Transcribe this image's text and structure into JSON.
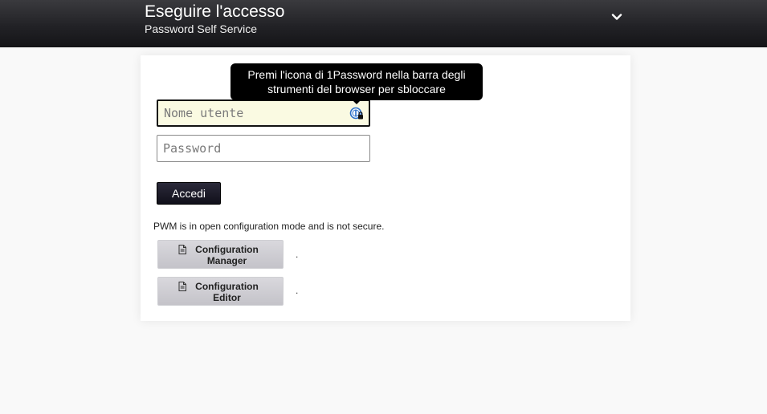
{
  "header": {
    "title": "Eseguire l'accesso",
    "subtitle": "Password Self Service",
    "menu_icon": "chevron-down-icon"
  },
  "tooltip": {
    "text": "Premi l'icona di 1Password nella barra degli strumenti del browser per sbloccare"
  },
  "login": {
    "username_placeholder": "Nome utente",
    "username_value": "",
    "password_placeholder": "Password",
    "password_value": "",
    "submit_label": "Accedi",
    "password_manager_icon": "1password-lock-icon"
  },
  "config": {
    "notice": "PWM is in open configuration mode and is not secure.",
    "buttons": [
      {
        "label": "Configuration Manager",
        "icon": "document-icon",
        "trailing": "."
      },
      {
        "label": "Configuration Editor",
        "icon": "document-icon",
        "trailing": "."
      }
    ]
  },
  "colors": {
    "header_bg": "#1c1c20",
    "page_bg": "#f9f9f9",
    "button_dark": "#14141e",
    "button_light": "#cfced4",
    "autofill_bg": "#fafae2"
  }
}
